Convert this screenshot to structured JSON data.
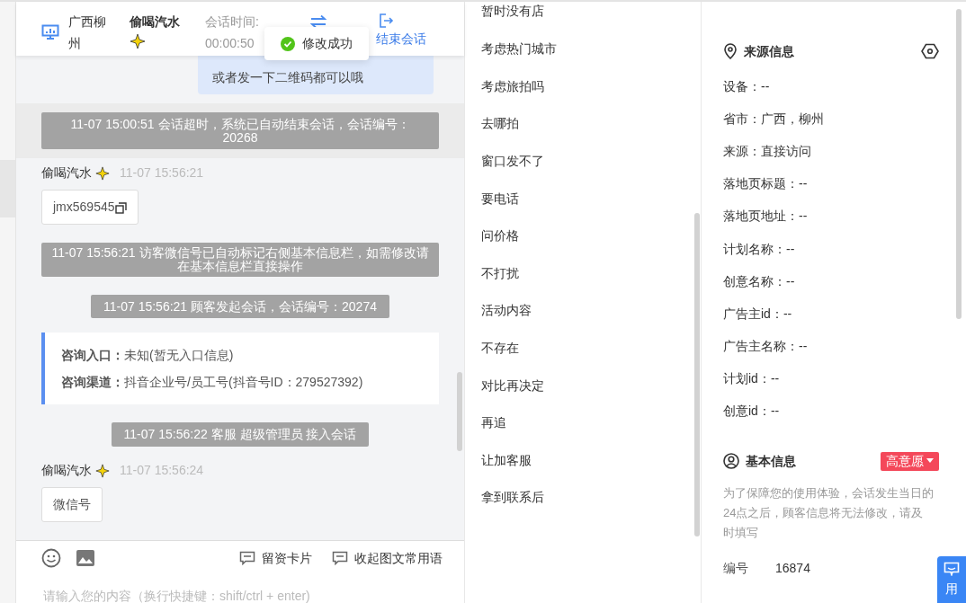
{
  "header": {
    "location": "广西柳州",
    "visitor": "偷喝汽水",
    "timer_label": "会话时间:",
    "timer": "00:00:50",
    "end_label": "结束会话"
  },
  "toast": {
    "text": "修改成功"
  },
  "messages": [
    {
      "kind": "bubble",
      "text": "或者发一下二维码都可以哦"
    },
    {
      "kind": "system",
      "text": "11-07 15:00:51 会话超时，系统已自动结束会话，会话编号：20268",
      "highlighted": true,
      "wide": true
    },
    {
      "kind": "visitor",
      "name": "偷喝汽水",
      "time": "11-07 15:56:21",
      "text": "jmx569545",
      "copy": true
    },
    {
      "kind": "system",
      "text": "11-07 15:56:21 访客微信号已自动标记右侧基本信息栏，如需修改请在基本信息栏直接操作",
      "highlighted": false,
      "wide": true
    },
    {
      "kind": "system",
      "text": "11-07 15:56:21 顾客发起会话，会话编号：20274",
      "highlighted": false,
      "wide": false
    },
    {
      "kind": "info",
      "rows": [
        {
          "label": "咨询入口：",
          "value": "未知(暂无入口信息)"
        },
        {
          "label": "咨询渠道：",
          "value": "抖音企业号/员工号(抖音号ID：279527392)"
        }
      ]
    },
    {
      "kind": "system",
      "text": "11-07 15:56:22 客服 超级管理员 接入会话",
      "highlighted": false,
      "wide": false
    },
    {
      "kind": "visitor",
      "name": "偷喝汽水",
      "time": "11-07 15:56:24",
      "text": "微信号",
      "copy": false
    }
  ],
  "composer": {
    "tools": [
      "留资卡片",
      "收起图文常用语"
    ],
    "placeholder": "请输入您的内容（换行快捷键：shift/ctrl + enter)"
  },
  "quick_replies": [
    "暂时没有店",
    "考虑热门城市",
    "考虑旅拍吗",
    "去哪拍",
    "窗口发不了",
    "要电话",
    "问价格",
    "不打扰",
    "活动内容",
    "不存在",
    "对比再决定",
    "再追",
    "让加客服",
    "拿到联系后"
  ],
  "source_info": {
    "title": "来源信息",
    "items": [
      "设备：--",
      "省市：广西，柳州",
      "来源：直接访问",
      "落地页标题：--",
      "落地页地址：--",
      "计划名称：--",
      "创意名称：--",
      "广告主id：--",
      "广告主名称：--",
      "计划id：--",
      "创意id：--"
    ]
  },
  "basic_info": {
    "title": "基本信息",
    "intent": "高意愿",
    "note": "为了保障您的使用体验，会话发生当日的24点之后，顾客信息将无法修改，请及时填写",
    "fields": [
      {
        "label": "编号",
        "value": "16874"
      }
    ]
  },
  "float_button": {
    "text": "用"
  }
}
